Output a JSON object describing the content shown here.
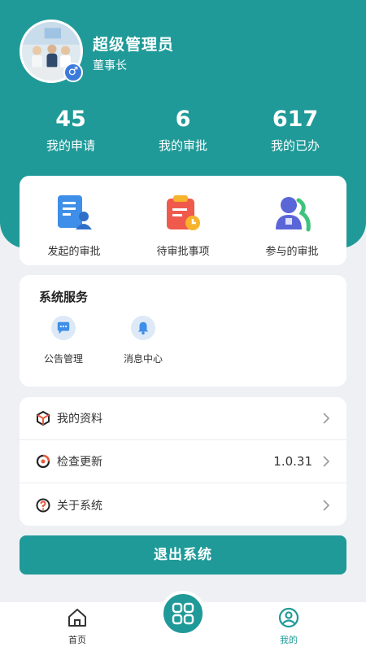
{
  "profile": {
    "name": "超级管理员",
    "role": "董事长",
    "gender_symbol": "♂"
  },
  "stats": [
    {
      "value": "45",
      "label": "我的申请"
    },
    {
      "value": "6",
      "label": "我的审批"
    },
    {
      "value": "617",
      "label": "我的已办"
    }
  ],
  "quick_actions": [
    {
      "label": "发起的审批",
      "icon": "document-user-icon"
    },
    {
      "label": "待审批事项",
      "icon": "clipboard-clock-icon"
    },
    {
      "label": "参与的审批",
      "icon": "people-icon"
    }
  ],
  "services": {
    "title": "系统服务",
    "items": [
      {
        "label": "公告管理",
        "icon": "chat-bubble-icon"
      },
      {
        "label": "消息中心",
        "icon": "bell-icon"
      }
    ]
  },
  "menu": [
    {
      "label": "我的资料",
      "icon": "cube-icon",
      "value": ""
    },
    {
      "label": "检查更新",
      "icon": "refresh-icon",
      "value": "1.0.31"
    },
    {
      "label": "关于系统",
      "icon": "question-icon",
      "value": ""
    }
  ],
  "logout_label": "退出系统",
  "tabbar": {
    "items": [
      {
        "label": "首页",
        "icon": "home-icon",
        "active": false
      },
      {
        "label": "",
        "icon": "grid-icon",
        "active": false
      },
      {
        "label": "我的",
        "icon": "user-circle-icon",
        "active": true
      }
    ]
  },
  "colors": {
    "primary": "#1f9a98",
    "background": "#eef0f4",
    "active_tab": "#1f9a98"
  }
}
